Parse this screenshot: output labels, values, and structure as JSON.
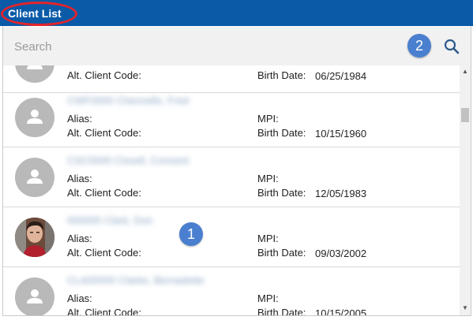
{
  "window": {
    "title": "Client List"
  },
  "search": {
    "placeholder": "Search"
  },
  "labels": {
    "alias": "Alias:",
    "alt_client_code": "Alt. Client Code:",
    "mpi": "MPI:",
    "birth_date": "Birth Date:"
  },
  "annotations": {
    "badge_1": "1",
    "badge_2": "2"
  },
  "clients": [
    {
      "name": "",
      "birth_date": "06/25/1984",
      "avatar": "person-icon"
    },
    {
      "name": "CWF0000 Chennells, Fred",
      "birth_date": "10/15/1960",
      "avatar": "person-icon"
    },
    {
      "name": "CSC0000 Cissell, Consent",
      "birth_date": "12/05/1983",
      "avatar": "person-icon"
    },
    {
      "name": "000005 Clark, Don",
      "birth_date": "09/03/2002",
      "avatar": "photo"
    },
    {
      "name": "CLA00000 Clarke, Bernadette",
      "birth_date": "10/15/2005",
      "avatar": "person-icon"
    }
  ],
  "colors": {
    "titlebar": "#0a5aa8",
    "highlight_ring": "#e4242a",
    "badge": "#4a7fd0",
    "search_bg": "#f1f1f1",
    "avatar_gray": "#b9b9b9"
  }
}
